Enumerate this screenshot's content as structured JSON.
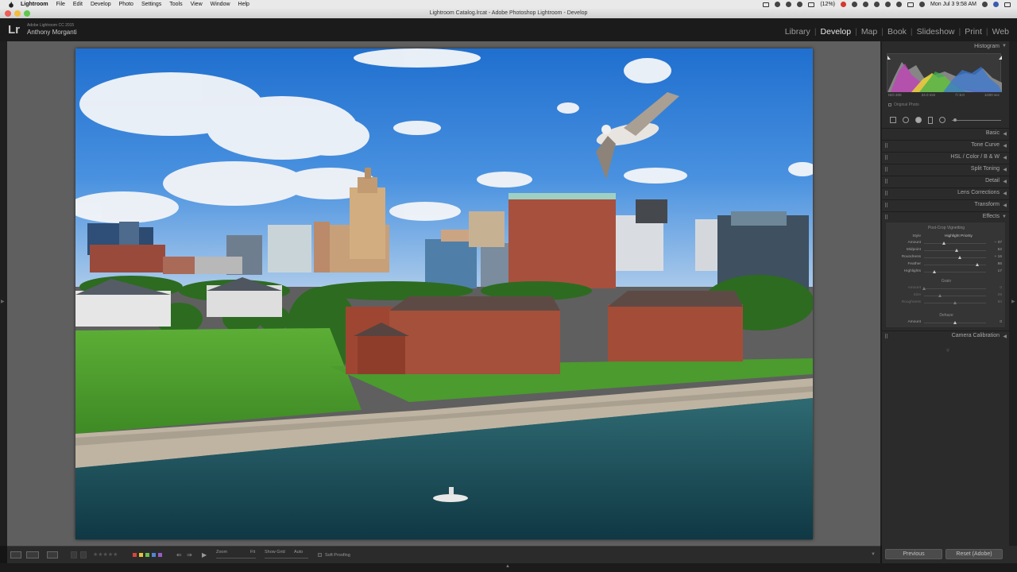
{
  "menubar": {
    "items": [
      "Lightroom",
      "File",
      "Edit",
      "Develop",
      "Photo",
      "Settings",
      "Tools",
      "View",
      "Window",
      "Help"
    ],
    "battery": "(12%)",
    "clock": "Mon Jul 3  9:58 AM"
  },
  "window": {
    "title": "Lightroom Catalog.lrcat - Adobe Photoshop Lightroom - Develop"
  },
  "identity": {
    "logo": "Lr",
    "version": "Adobe Lightroom CC 2015",
    "user": "Anthony Morganti"
  },
  "modules": {
    "items": [
      "Library",
      "Develop",
      "Map",
      "Book",
      "Slideshow",
      "Print",
      "Web"
    ],
    "active": "Develop"
  },
  "histogram": {
    "title": "Histogram",
    "iso": "ISO 200",
    "focal": "24.0 mm",
    "aperture": "f / 8.0",
    "shutter": "1⁄400 sec",
    "original_photo_label": "Original Photo"
  },
  "panels": {
    "basic": "Basic",
    "tone_curve": "Tone Curve",
    "hsl": "HSL  /  Color  /  B & W",
    "split_toning": "Split Toning",
    "detail": "Detail",
    "lens_corrections": "Lens Corrections",
    "transform": "Transform",
    "effects": "Effects",
    "camera_calibration": "Camera Calibration"
  },
  "effects": {
    "vignetting_title": "Post-Crop Vignetting",
    "style_label": "Style",
    "style_value": "Highlight Priority",
    "vignette": [
      {
        "name": "Amount",
        "value": "− 37",
        "pos": 0.32
      },
      {
        "name": "Midpoint",
        "value": "52",
        "pos": 0.52
      },
      {
        "name": "Roundness",
        "value": "+ 16",
        "pos": 0.58
      },
      {
        "name": "Feather",
        "value": "86",
        "pos": 0.86
      },
      {
        "name": "Highlights",
        "value": "17",
        "pos": 0.17
      }
    ],
    "grain_title": "Grain",
    "grain": [
      {
        "name": "Amount",
        "value": "0",
        "pos": 0.0
      },
      {
        "name": "Size",
        "value": "25",
        "pos": 0.25
      },
      {
        "name": "Roughness",
        "value": "50",
        "pos": 0.5
      }
    ],
    "dehaze_title": "Dehaze",
    "dehaze": [
      {
        "name": "Amount",
        "value": "0",
        "pos": 0.5
      }
    ]
  },
  "buttons": {
    "previous": "Previous",
    "reset": "Reset (Adobe)"
  },
  "toolbar": {
    "stars": "★★★★★",
    "zoom_label": "Zoom",
    "zoom_value": "Fit",
    "show_grid_label": "Show Grid",
    "show_grid_value": "Auto",
    "soft_proofing": "Soft Proofing",
    "color_labels": [
      "#d8453c",
      "#e5c33a",
      "#6bbf4a",
      "#4f86d6",
      "#9a5cc7"
    ]
  }
}
